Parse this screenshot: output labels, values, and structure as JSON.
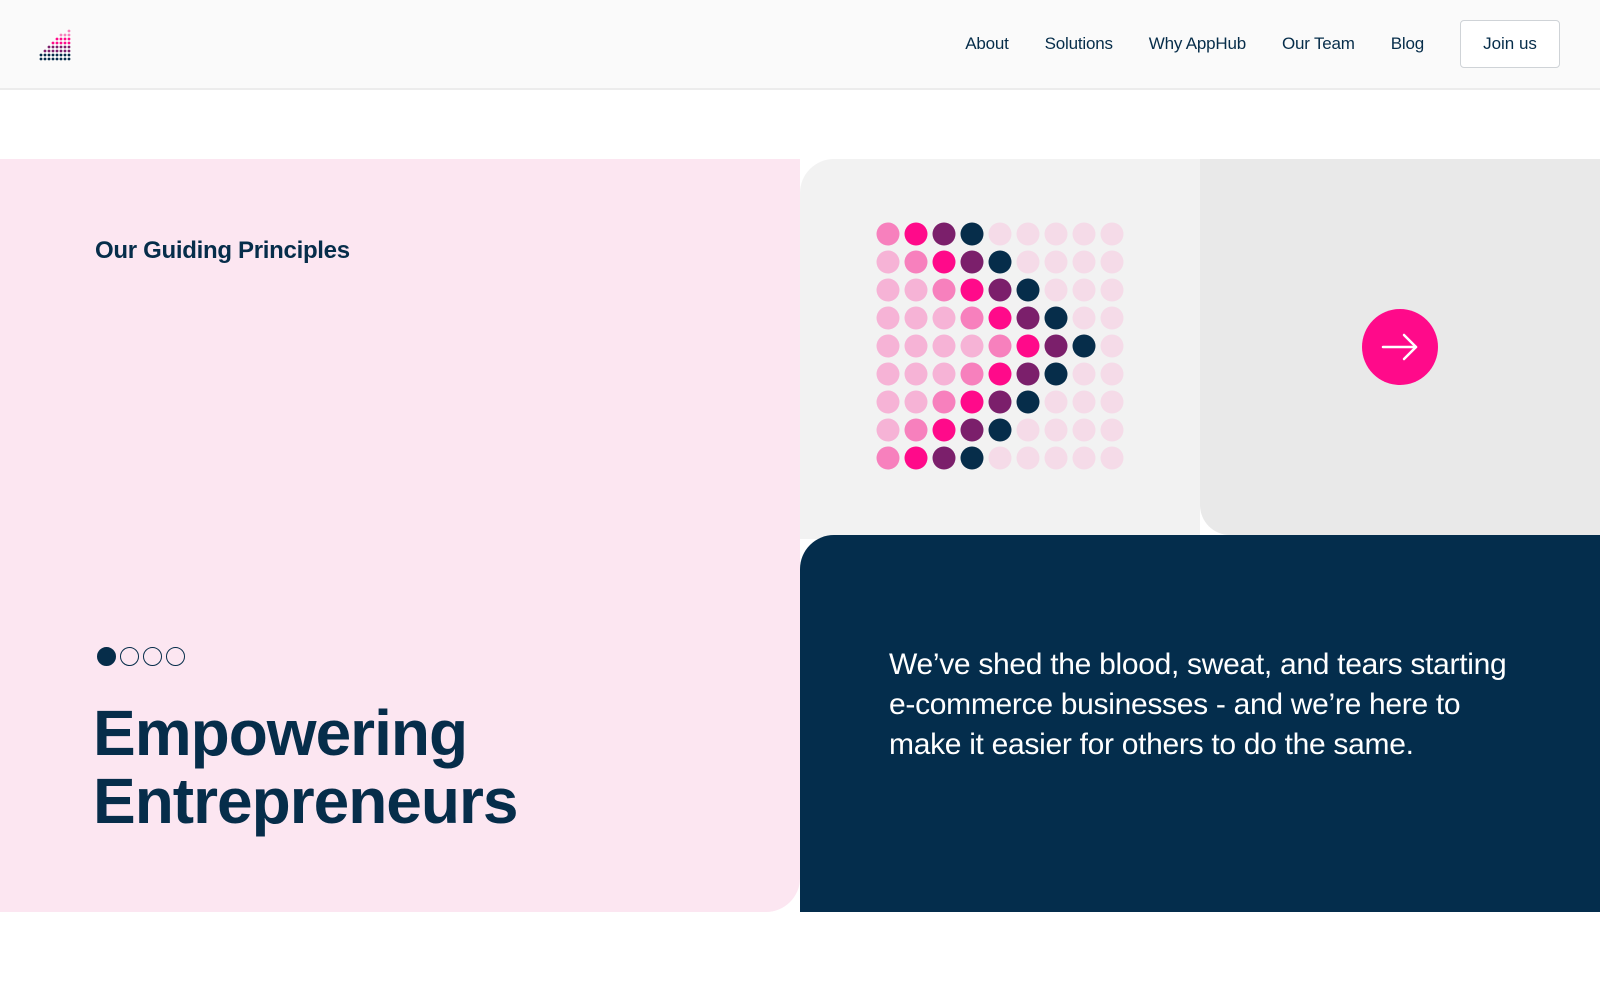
{
  "header": {
    "logo_icon": "dot-matrix-logo-icon",
    "nav": [
      {
        "label": "About"
      },
      {
        "label": "Solutions"
      },
      {
        "label": "Why AppHub"
      },
      {
        "label": "Our Team"
      },
      {
        "label": "Blog"
      }
    ],
    "cta_label": "Join us"
  },
  "hero": {
    "section_label": "Our Guiding Principles",
    "pager": {
      "count": 4,
      "active_index": 0
    },
    "title_line1": "Empowering",
    "title_line2": "Entrepreneurs",
    "quote": "We’ve shed the blood, sweat, and tears starting e-commerce businesses - and we’re here to make it easier for others to do the same.",
    "next_icon": "arrow-right-icon"
  },
  "colors": {
    "navy": "#062d4a",
    "pink_bg": "#fce6f1",
    "hot_pink": "#ff0a8a",
    "medium_pink": "#f780bd",
    "light_pink": "#f6b3d6",
    "pale_pink": "#f5dbe8",
    "plum": "#7b1f6b",
    "dark_panel": "#042d4c"
  }
}
